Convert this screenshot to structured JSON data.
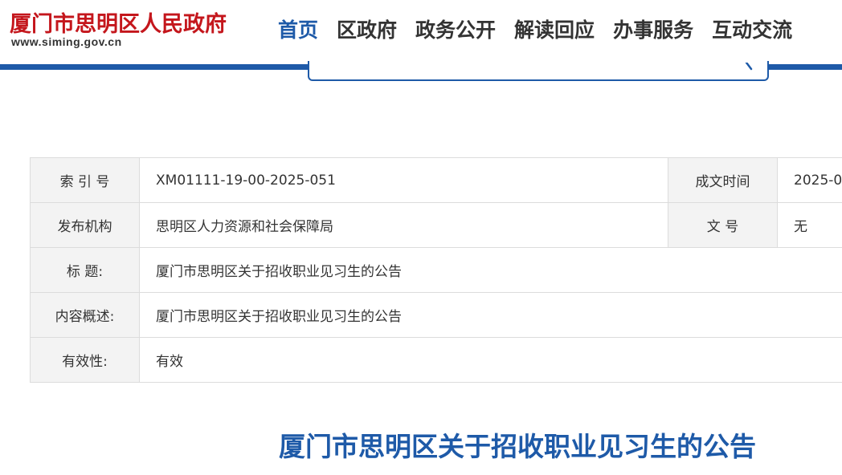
{
  "header": {
    "site_title": "厦门市思明区人民政府",
    "site_url": "www.siming.gov.cn",
    "nav": [
      {
        "label": "首页",
        "active": true
      },
      {
        "label": "区政府",
        "active": false
      },
      {
        "label": "政务公开",
        "active": false
      },
      {
        "label": "解读回应",
        "active": false
      },
      {
        "label": "办事服务",
        "active": false
      },
      {
        "label": "互动交流",
        "active": false
      }
    ],
    "accent_color": "#1e5aa8",
    "brand_color": "#c4161c"
  },
  "search": {
    "icon": "search-icon"
  },
  "info": {
    "index_label": "索 引 号",
    "index_value": "XM01111-19-00-2025-051",
    "date_label": "成文时间",
    "date_value": "2025-0",
    "publisher_label": "发布机构",
    "publisher_value": "思明区人力资源和社会保障局",
    "doc_no_label": "文 号",
    "doc_no_value": "无",
    "title_label": "标 题:",
    "title_value": "厦门市思明区关于招收职业见习生的公告",
    "summary_label": "内容概述:",
    "summary_value": "厦门市思明区关于招收职业见习生的公告",
    "validity_label": "有效性:",
    "validity_value": "有效"
  },
  "article": {
    "title": "厦门市思明区关于招收职业见习生的公告"
  }
}
